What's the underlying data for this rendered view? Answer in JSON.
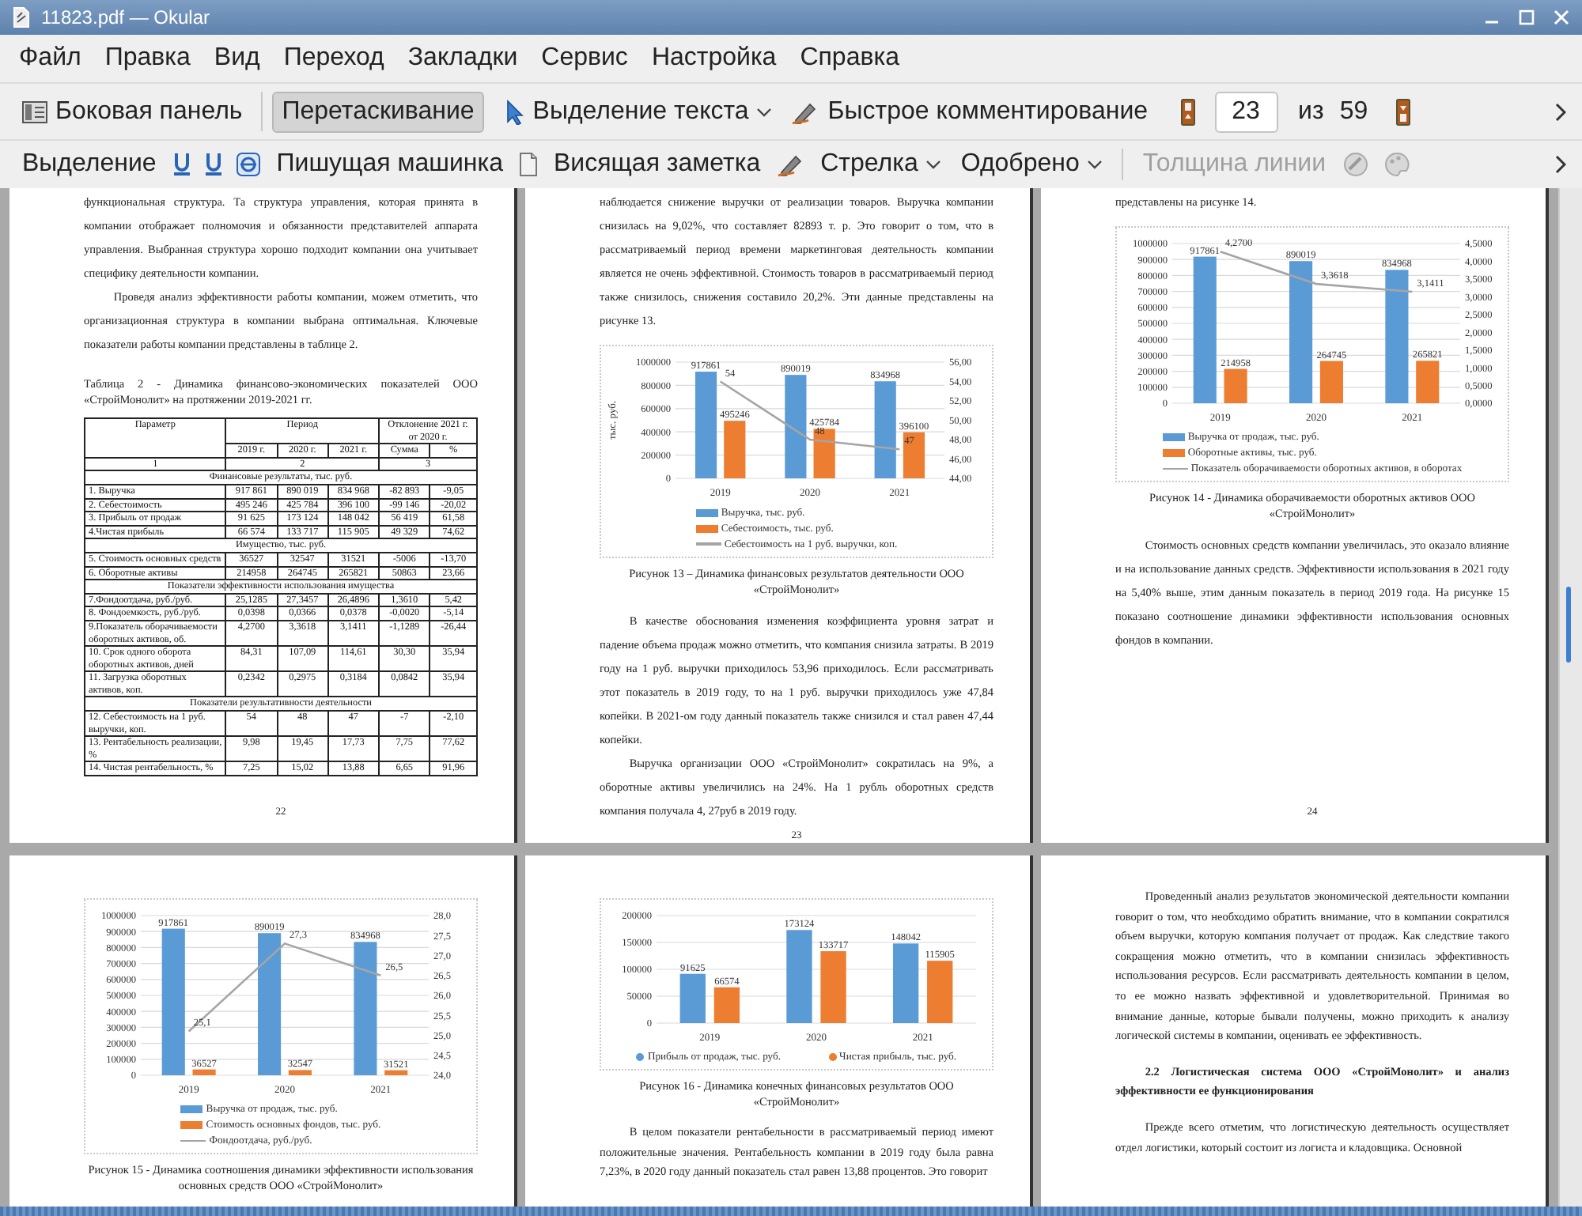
{
  "window": {
    "title": "11823.pdf — Okular"
  },
  "menu": [
    "Файл",
    "Правка",
    "Вид",
    "Переход",
    "Закладки",
    "Сервис",
    "Настройка",
    "Справка"
  ],
  "toolbar_main": {
    "items": [
      {
        "kind": "toggle",
        "label": "Боковая панель",
        "selected": false
      },
      {
        "kind": "toggle",
        "label": "Перетаскивание",
        "selected": true
      },
      {
        "kind": "dropdown",
        "label": "Выделение текста",
        "selected": false
      },
      {
        "kind": "button",
        "label": "Быстрое комментирование",
        "selected": false
      }
    ],
    "page": {
      "current": "23",
      "of_label": "из",
      "total": "59"
    }
  },
  "toolbar_annotations": {
    "items": [
      {
        "kind": "button",
        "label": "Выделение",
        "disabled": false
      },
      {
        "kind": "button",
        "label": "Пишущая машинка",
        "disabled": false
      },
      {
        "kind": "button",
        "label": "Висящая заметка",
        "disabled": false
      },
      {
        "kind": "dropdown",
        "label": "Стрелка",
        "disabled": false
      },
      {
        "kind": "dropdown",
        "label": "Одобрено",
        "disabled": false
      },
      {
        "kind": "button",
        "label": "Толщина линии",
        "disabled": true
      }
    ]
  },
  "document": {
    "pages": [
      {
        "number": "22",
        "blocks": [
          {
            "kind": "paragraph",
            "indent": false,
            "text": "функциональная структура. Та структура управления, которая принята в компании отображает полномочия и обязанности представителей аппарата управления. Выбранная структура хорошо подходит компании она учитывает специфику деятельности компании."
          },
          {
            "kind": "paragraph",
            "indent": true,
            "text": "Проведя анализ эффективности работы компании, можем отметить, что организационная структура в компании выбрана оптимальная. Ключевые показатели работы компании представлены в таблице 2."
          },
          {
            "kind": "table_caption",
            "text": "Таблица 2 - Динамика финансово-экономических показателей ООО «СтройМонолит» на протяжении 2019-2021 гг."
          },
          {
            "kind": "table",
            "head": {
              "parameter": "Параметр",
              "period": "Период",
              "deviation": "Отклонение 2021 г. от 2020 г.",
              "years": [
                "2019 г.",
                "2020 г.",
                "2021 г."
              ],
              "deviation_columns": [
                "Сумма",
                "%"
              ],
              "numbering": [
                "1",
                "2",
                "3"
              ]
            },
            "rows": [
              {
                "kind": "section",
                "text": "Финансовые результаты, тыс. руб."
              },
              {
                "kind": "data",
                "cells": [
                  "1. Выручка",
                  "917 861",
                  "890 019",
                  "834 968",
                  "-82 893",
                  "-9,05"
                ]
              },
              {
                "kind": "data",
                "cells": [
                  "2. Себестоимость",
                  "495 246",
                  "425 784",
                  "396 100",
                  "-99 146",
                  "-20,02"
                ]
              },
              {
                "kind": "data",
                "cells": [
                  "3. Прибыль от продаж",
                  "91 625",
                  "173 124",
                  "148 042",
                  "56 419",
                  "61,58"
                ]
              },
              {
                "kind": "data",
                "cells": [
                  "4.Чистая прибыль",
                  "66 574",
                  "133 717",
                  "115 905",
                  "49 329",
                  "74,62"
                ]
              },
              {
                "kind": "section",
                "text": "Имущество, тыс. руб."
              },
              {
                "kind": "data",
                "cells": [
                  "5. Стоимость основных средств",
                  "36527",
                  "32547",
                  "31521",
                  "-5006",
                  "-13,70"
                ]
              },
              {
                "kind": "data",
                "cells": [
                  "6. Оборотные активы",
                  "214958",
                  "264745",
                  "265821",
                  "50863",
                  "23,66"
                ]
              },
              {
                "kind": "section",
                "text": "Показатели эффективности использования имущества"
              },
              {
                "kind": "data",
                "cells": [
                  "7.Фондоотдача, руб./руб.",
                  "25,1285",
                  "27,3457",
                  "26,4896",
                  "1,3610",
                  "5,42"
                ]
              },
              {
                "kind": "data",
                "cells": [
                  "8. Фондоемкость, руб./руб.",
                  "0,0398",
                  "0,0366",
                  "0,0378",
                  "-0,0020",
                  "-5,14"
                ]
              },
              {
                "kind": "data",
                "cells": [
                  "9.Показатель оборачиваемости оборотных активов, об.",
                  "4,2700",
                  "3,3618",
                  "3,1411",
                  "-1,1289",
                  "-26,44"
                ]
              },
              {
                "kind": "data",
                "cells": [
                  "10. Срок одного оборота оборотных активов, дней",
                  "84,31",
                  "107,09",
                  "114,61",
                  "30,30",
                  "35,94"
                ]
              },
              {
                "kind": "data",
                "cells": [
                  "11. Загрузка оборотных активов, коп.",
                  "0,2342",
                  "0,2975",
                  "0,3184",
                  "0,0842",
                  "35,94"
                ]
              },
              {
                "kind": "section",
                "text": "Показатели результативности деятельности"
              },
              {
                "kind": "data",
                "cells": [
                  "12. Себестоимость на 1 руб. выручки, коп.",
                  "54",
                  "48",
                  "47",
                  "-7",
                  "-2,10"
                ]
              },
              {
                "kind": "data",
                "cells": [
                  "13. Рентабельность реализации, %",
                  "9,98",
                  "19,45",
                  "17,73",
                  "7,75",
                  "77,62"
                ]
              },
              {
                "kind": "data",
                "cells": [
                  "14. Чистая рентабельность, %",
                  "7,25",
                  "15,02",
                  "13,88",
                  "6,65",
                  "91,96"
                ]
              }
            ]
          }
        ]
      },
      {
        "number": "23",
        "blocks": [
          {
            "kind": "paragraph",
            "indent": false,
            "text": "наблюдается снижение выручки от реализации товаров. Выручка компании снизилась на 9,02%, что составляет 82893 т. р. Это говорит о том, что в рассматриваемый период времени маркетинговая деятельность компании является не очень эффективной. Стоимость товаров в рассматриваемый период также снизилось, снижения составило 20,2%. Эти данные представлены на рисунке 13."
          },
          {
            "kind": "chart",
            "chart_data": {
              "type": "bar",
              "ylabel": "тыс. руб.",
              "categories": [
                "2019",
                "2020",
                "2021"
              ],
              "data_labels": true,
              "grid": true,
              "legend": "bottom",
              "ylim": [
                0,
                1000000
              ],
              "yticks": [
                0,
                200000,
                400000,
                600000,
                800000,
                1000000
              ],
              "y2lim": [
                44,
                56
              ],
              "y2ticks": [
                {
                  "value": 44,
                  "label": "44,00"
                },
                {
                  "value": 46,
                  "label": "46,00"
                },
                {
                  "value": 48,
                  "label": "48,00"
                },
                {
                  "value": 50,
                  "label": "50,00"
                },
                {
                  "value": 52,
                  "label": "52,00"
                },
                {
                  "value": 54,
                  "label": "54,00"
                },
                {
                  "value": 56,
                  "label": "56,00"
                }
              ],
              "series": [
                {
                  "name": "Выручка, тыс. руб.",
                  "type": "bar",
                  "color": "#5b9bd5",
                  "values": [
                    917861,
                    890019,
                    834968
                  ]
                },
                {
                  "name": "Себестоимость, тыс. руб.",
                  "type": "bar",
                  "color": "#ed7d31",
                  "values": [
                    495246,
                    425784,
                    396100
                  ]
                },
                {
                  "name": "Себестоимость на 1 руб. выручки, коп.",
                  "type": "line",
                  "axis": "y2",
                  "color": "#a5a5a5",
                  "values": [
                    54,
                    48,
                    47
                  ],
                  "value_labels": [
                    "54",
                    "48",
                    "47"
                  ]
                }
              ]
            }
          },
          {
            "kind": "caption",
            "text": "Рисунок 13 – Динамика финансовых результатов деятельности ООО «СтройМонолит»"
          },
          {
            "kind": "paragraph",
            "indent": true,
            "text": "В качестве обоснования изменения коэффициента уровня затрат и падение объема продаж можно отметить, что компания снизила затраты. В 2019 году на 1 руб. выручки приходилось 53,96 приходилось. Если рассматривать этот показатель в 2019 году, то на 1 руб. выручки приходилось уже 47,84 копейки. В 2021-ом году данный показатель также снизился и стал равен 47,44 копейки."
          },
          {
            "kind": "paragraph",
            "indent": true,
            "text": "Выручка организации ООО «СтройМонолит» сократилась на 9%, а оборотные активы увеличились на 24%.  На 1 рубль оборотных средств компания получала 4, 27руб в 2019 году."
          }
        ]
      },
      {
        "number": "24",
        "blocks": [
          {
            "kind": "paragraph",
            "indent": false,
            "text": "представлены на рисунке 14."
          },
          {
            "kind": "chart",
            "chart_data": {
              "type": "bar",
              "categories": [
                "2019",
                "2020",
                "2021"
              ],
              "data_labels": true,
              "grid": true,
              "legend": "bottom",
              "ylim": [
                0,
                1000000
              ],
              "yticks": [
                0,
                100000,
                200000,
                300000,
                400000,
                500000,
                600000,
                700000,
                800000,
                900000,
                1000000
              ],
              "y2lim": [
                0,
                4.5
              ],
              "y2ticks": [
                {
                  "value": 0,
                  "label": "0,0000"
                },
                {
                  "value": 0.5,
                  "label": "0,5000"
                },
                {
                  "value": 1,
                  "label": "1,0000"
                },
                {
                  "value": 1.5,
                  "label": "1,5000"
                },
                {
                  "value": 2,
                  "label": "2,0000"
                },
                {
                  "value": 2.5,
                  "label": "2,5000"
                },
                {
                  "value": 3,
                  "label": "3,0000"
                },
                {
                  "value": 3.5,
                  "label": "3,5000"
                },
                {
                  "value": 4,
                  "label": "4,0000"
                },
                {
                  "value": 4.5,
                  "label": "4,5000"
                }
              ],
              "series": [
                {
                  "name": "Выручка от продаж, тыс. руб.",
                  "type": "bar",
                  "color": "#5b9bd5",
                  "values": [
                    917861,
                    890019,
                    834968
                  ]
                },
                {
                  "name": "Оборотные активы, тыс. руб.",
                  "type": "bar",
                  "color": "#ed7d31",
                  "values": [
                    214958,
                    264745,
                    265821
                  ]
                },
                {
                  "name": "Показатель оборачиваемости оборотных активов, в оборотах",
                  "type": "line",
                  "axis": "y2",
                  "color": "#a5a5a5",
                  "values": [
                    4.27,
                    3.3618,
                    3.1411
                  ],
                  "value_labels": [
                    "4,2700",
                    "3,3618",
                    "3,1411"
                  ]
                }
              ]
            }
          },
          {
            "kind": "caption",
            "text": "Рисунок 14 - Динамика оборачиваемости оборотных активов ООО «СтройМонолит»"
          },
          {
            "kind": "paragraph",
            "indent": true,
            "text": "Стоимость основных средств компании увеличилась, это оказало влияние и на использование данных средств. Эффективности использования в 2021 году на 5,40% выше, этим данным показатель в период 2019 года. На рисунке 15 показано соотношение динамики эффективности использования основных фондов в компании."
          }
        ]
      },
      {
        "blocks": [
          {
            "kind": "chart",
            "chart_data": {
              "type": "bar",
              "categories": [
                "2019",
                "2020",
                "2021"
              ],
              "data_labels": true,
              "grid": true,
              "legend": "bottom",
              "ylim": [
                0,
                1000000
              ],
              "yticks": [
                0,
                100000,
                200000,
                300000,
                400000,
                500000,
                600000,
                700000,
                800000,
                900000,
                1000000
              ],
              "y2lim": [
                24,
                28
              ],
              "y2ticks": [
                {
                  "value": 24,
                  "label": "24,0"
                },
                {
                  "value": 24.5,
                  "label": "24,5"
                },
                {
                  "value": 25,
                  "label": "25,0"
                },
                {
                  "value": 25.5,
                  "label": "25,5"
                },
                {
                  "value": 26,
                  "label": "26,0"
                },
                {
                  "value": 26.5,
                  "label": "26,5"
                },
                {
                  "value": 27,
                  "label": "27,0"
                },
                {
                  "value": 27.5,
                  "label": "27,5"
                },
                {
                  "value": 28,
                  "label": "28,0"
                }
              ],
              "series": [
                {
                  "name": "Выручка от продаж, тыс. руб.",
                  "type": "bar",
                  "color": "#5b9bd5",
                  "values": [
                    917861,
                    890019,
                    834968
                  ]
                },
                {
                  "name": "Стоимость основных фондов, тыс. руб.",
                  "type": "bar",
                  "color": "#ed7d31",
                  "values": [
                    36527,
                    32547,
                    31521
                  ]
                },
                {
                  "name": "Фондоотдача, руб./руб.",
                  "type": "line",
                  "axis": "y2",
                  "color": "#a5a5a5",
                  "values": [
                    25.1,
                    27.3,
                    26.5
                  ],
                  "value_labels": [
                    "25,1",
                    "27,3",
                    "26,5"
                  ]
                }
              ]
            }
          },
          {
            "kind": "caption",
            "text": "Рисунок 15 - Динамика соотношения динамики эффективности использования основных средств ООО «СтройМонолит»"
          }
        ]
      },
      {
        "blocks": [
          {
            "kind": "chart",
            "chart_data": {
              "type": "bar",
              "categories": [
                "2019",
                "2020",
                "2021"
              ],
              "data_labels": true,
              "grid": true,
              "legend": "bottom",
              "ylim": [
                0,
                200000
              ],
              "yticks": [
                0,
                50000,
                100000,
                150000,
                200000
              ],
              "series": [
                {
                  "name": "Прибыль от продаж, тыс. руб.",
                  "type": "bar",
                  "color": "#5b9bd5",
                  "values": [
                    91625,
                    173124,
                    148042
                  ]
                },
                {
                  "name": "Чистая прибыль, тыс. руб.",
                  "type": "bar",
                  "color": "#ed7d31",
                  "values": [
                    66574,
                    133717,
                    115905
                  ]
                }
              ]
            }
          },
          {
            "kind": "caption",
            "text": "Рисунок 16 - Динамика конечных финансовых результатов ООО «СтройМонолит»"
          },
          {
            "kind": "paragraph",
            "indent": true,
            "text": "В целом показатели рентабельности в рассматриваемый период имеют положительные значения. Рентабельность компании в 2019 году была равна 7,23%, в 2020 году данный показатель стал равен 13,88 процентов. Это говорит"
          }
        ]
      },
      {
        "blocks": [
          {
            "kind": "paragraph",
            "indent": true,
            "text": "Проведенный анализ результатов экономической деятельности компании говорит о том, что необходимо обратить внимание, что в компании сократился объем выручки, которую компания получает от продаж. Как следствие такого сокращения можно отметить, что в компании снизилась эффективность использования ресурсов. Если рассматривать деятельность компании в целом, то ее можно назвать эффективной и удовлетворительной. Принимая во внимание данные, которые бывали получены, можно приходить к анализу логической системы в компании, оценивать ее эффективность."
          },
          {
            "kind": "heading",
            "text": "2.2 Логистическая система ООО «СтройМонолит» и анализ эффективности ее функционирования"
          },
          {
            "kind": "paragraph",
            "indent": true,
            "text": "Прежде всего отметим, что логистическую деятельность осуществляет отдел логистики, который состоит из логиста и кладовщика. Основной"
          }
        ]
      }
    ]
  }
}
